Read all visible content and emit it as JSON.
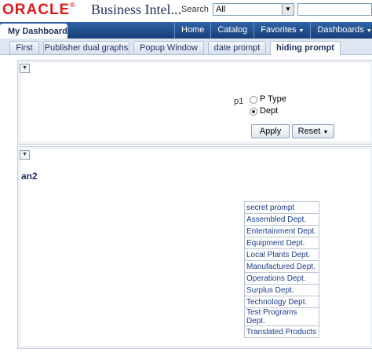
{
  "header": {
    "logo": "ORACLE",
    "product": "Business Intel...",
    "search_label": "Search",
    "search_scope": "All"
  },
  "nav": {
    "dashboard_title": "My Dashboard",
    "links": [
      "Home",
      "Catalog",
      "Favorites",
      "Dashboards"
    ]
  },
  "tabs": [
    "First",
    "Publisher dual graphs",
    "Popup Window",
    "date prompt",
    "hiding prompt"
  ],
  "prompt": {
    "param_label": "p1",
    "options": [
      "P Type",
      "Dept"
    ],
    "selected": "Dept",
    "apply_label": "Apply",
    "reset_label": "Reset"
  },
  "analysis": {
    "title": "an2",
    "header": "secret prompt",
    "rows": [
      "Assembled Dept.",
      "Entertainment Dept.",
      "Equipment Dept.",
      "Local Plants Dept.",
      "Manufactured Dept.",
      "Operations Dept.",
      "Surplus Dept.",
      "Technology Dept.",
      "Test Programs Dept.",
      "Translated Products"
    ]
  }
}
